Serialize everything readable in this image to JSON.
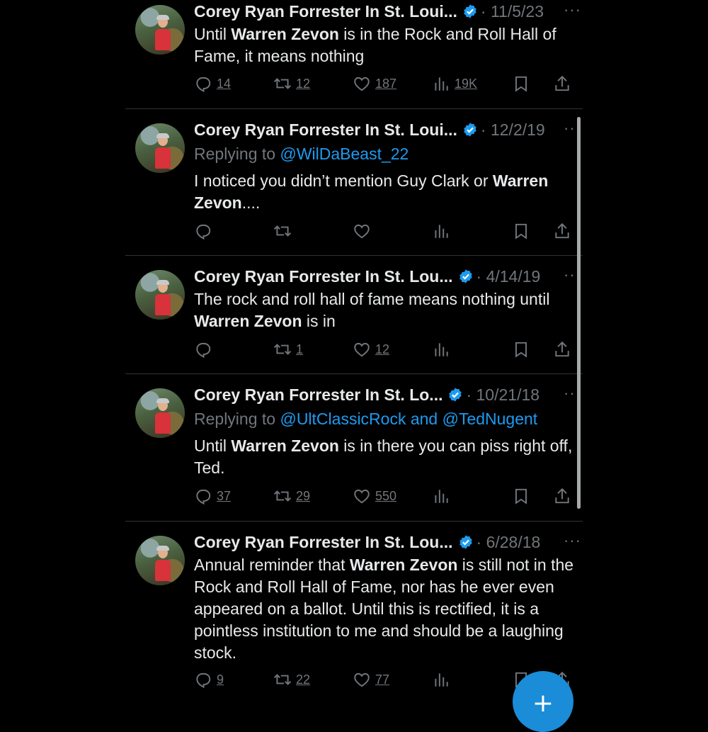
{
  "colors": {
    "background": "#000000",
    "text": "#e7e9ea",
    "muted": "#71767b",
    "accent": "#1d9bf0",
    "divider": "#2f3336"
  },
  "icons": {
    "reply": "reply-icon",
    "retweet": "retweet-icon",
    "like": "like-icon",
    "views": "views-icon",
    "bookmark": "bookmark-icon",
    "share": "share-icon",
    "verified": "verified-badge-icon",
    "more": "more-icon",
    "compose": "plus-icon"
  },
  "more_label": "···",
  "tweets": [
    {
      "name": "Corey Ryan Forrester In St. Loui...",
      "date": "· 11/5/23",
      "reply_to": null,
      "text_parts": [
        "Until ",
        "Warren Zevon",
        " is in the Rock and Roll Hall of Fame, it means nothing"
      ],
      "replies": "14",
      "retweets": "12",
      "likes": "187",
      "views": "19K"
    },
    {
      "name": "Corey Ryan Forrester In St. Loui...",
      "date": "· 12/2/19",
      "reply_to": {
        "prefix": "Replying to ",
        "mentions": "@WilDaBeast_22"
      },
      "text_parts": [
        "I noticed you didn’t mention Guy Clark or ",
        "Warren Zevon",
        "...."
      ],
      "replies": "",
      "retweets": "",
      "likes": "",
      "views": ""
    },
    {
      "name": "Corey Ryan Forrester In St. Lou...",
      "date": "· 4/14/19",
      "reply_to": null,
      "text_parts": [
        "The rock and roll hall of fame means nothing until ",
        "Warren Zevon",
        " is in"
      ],
      "replies": "",
      "retweets": "1",
      "likes": "12",
      "views": ""
    },
    {
      "name": "Corey Ryan Forrester In St. Lo...",
      "date": "· 10/21/18",
      "reply_to": {
        "prefix": "Replying to ",
        "mentions": "@UltClassicRock and @TedNugent"
      },
      "text_parts": [
        "Until ",
        "Warren Zevon",
        " is in there you can piss right off, Ted."
      ],
      "replies": "37",
      "retweets": "29",
      "likes": "550",
      "views": ""
    },
    {
      "name": "Corey Ryan Forrester In St. Lou...",
      "date": "· 6/28/18",
      "reply_to": null,
      "text_parts": [
        "Annual reminder that ",
        "Warren Zevon",
        " is still not in the Rock and Roll Hall of Fame, nor has he ever even appeared on a ballot. Until this is rectified, it is a pointless institution to me and should be a laughing stock."
      ],
      "replies": "9",
      "retweets": "22",
      "likes": "77",
      "views": ""
    }
  ],
  "compose_label": "+"
}
